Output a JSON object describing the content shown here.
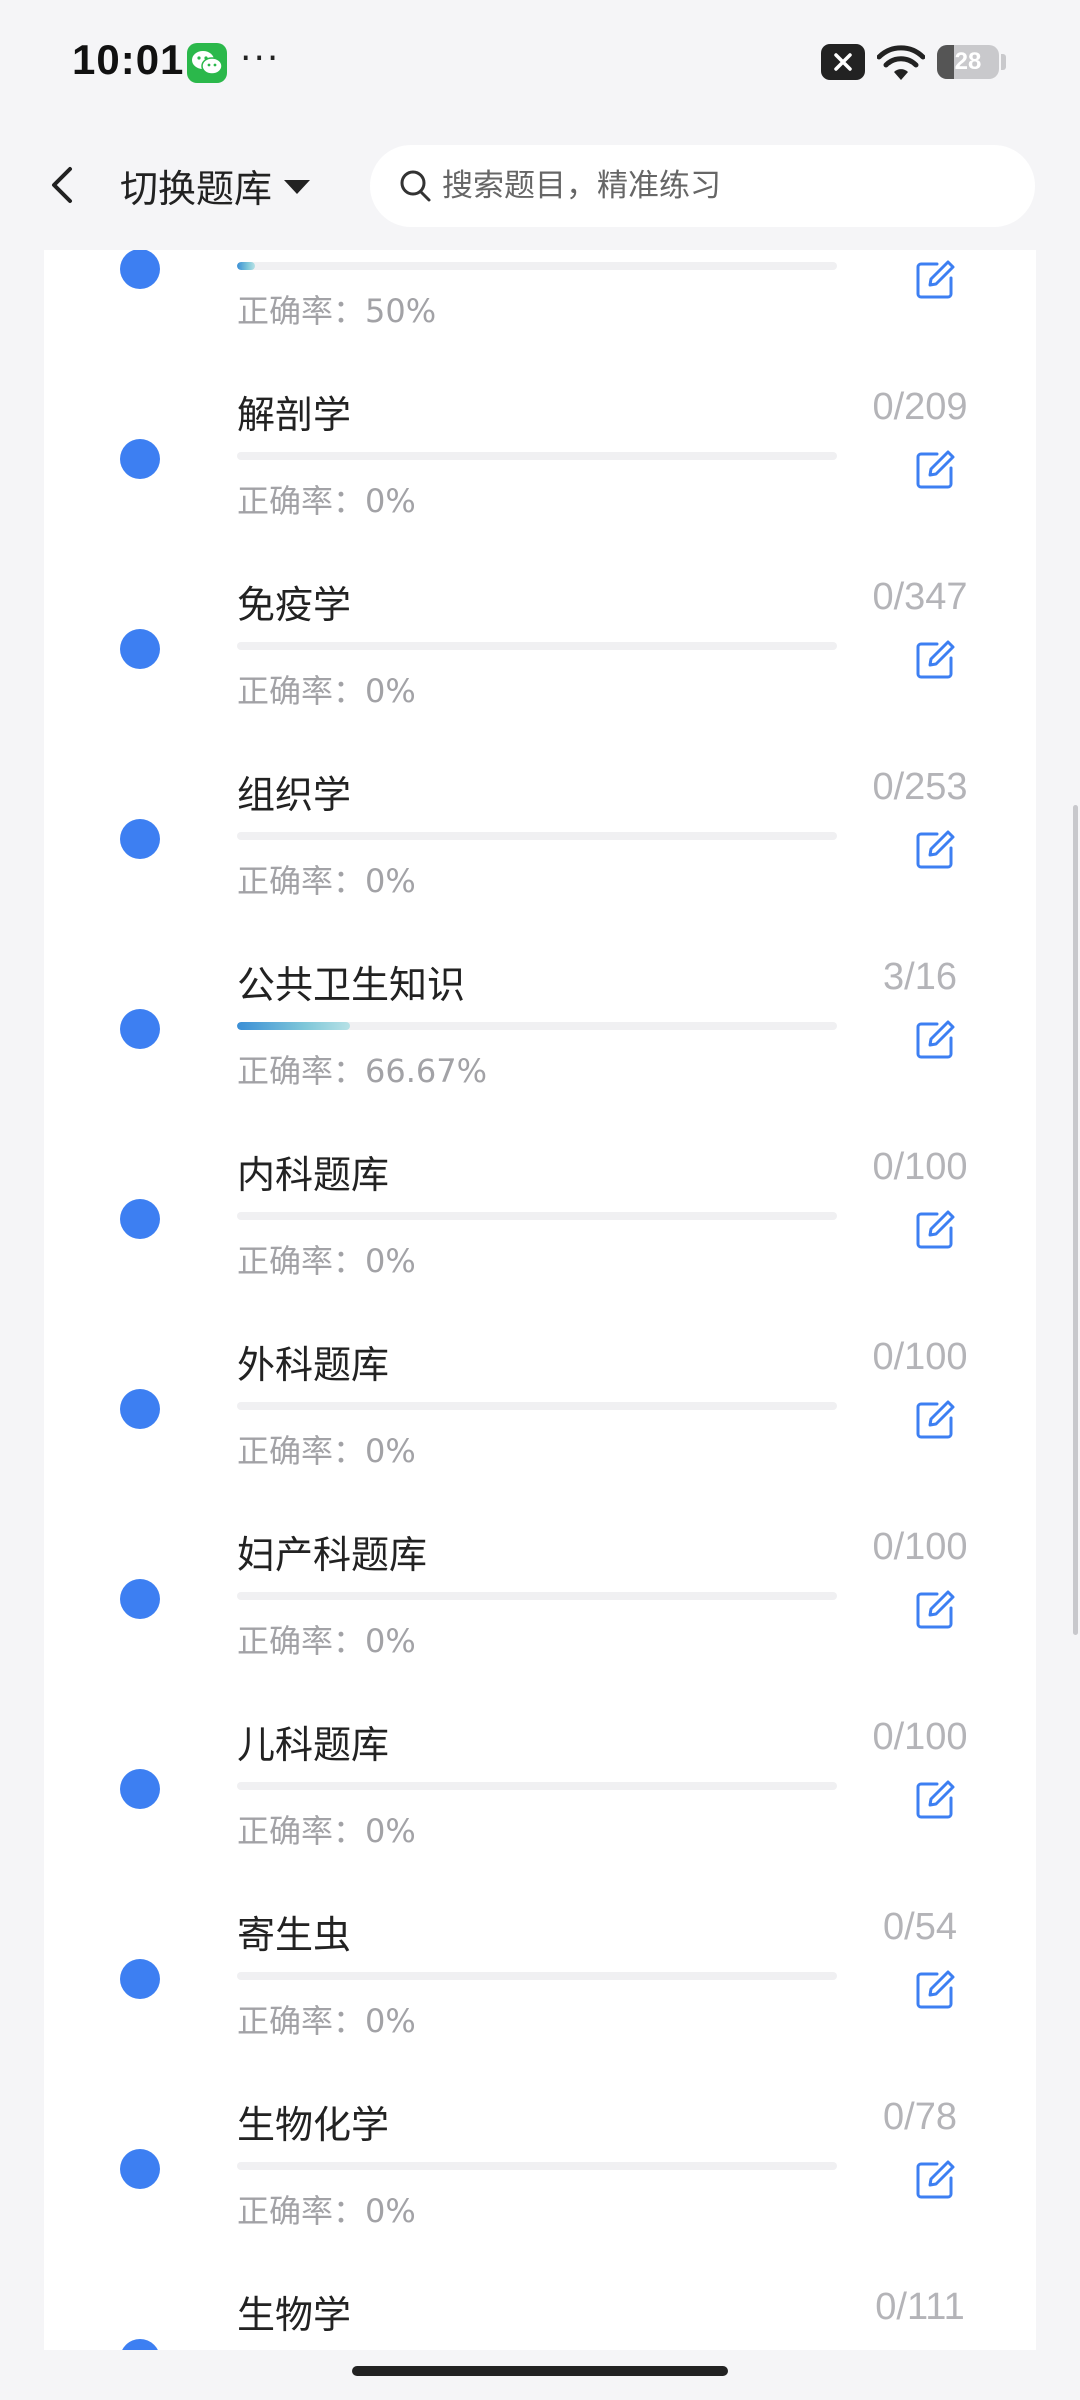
{
  "status_bar": {
    "time": "10:01",
    "more": "···",
    "battery": "28",
    "battery_level": 0.28,
    "icons": [
      "wechat-icon",
      "sim-blocked-icon",
      "wifi-icon",
      "battery-icon"
    ]
  },
  "header": {
    "switch_bank_label": "切换题库",
    "search_placeholder": "搜索题目，精准练习"
  },
  "items": [
    {
      "title": "",
      "progress": 0.03,
      "accuracy": "正确率：50%",
      "count": ""
    },
    {
      "title": "解剖学",
      "progress": 0,
      "accuracy": "正确率：0%",
      "count": "0/209"
    },
    {
      "title": "免疫学",
      "progress": 0,
      "accuracy": "正确率：0%",
      "count": "0/347"
    },
    {
      "title": "组织学",
      "progress": 0,
      "accuracy": "正确率：0%",
      "count": "0/253"
    },
    {
      "title": "公共卫生知识",
      "progress": 0.1875,
      "accuracy": "正确率：66.67%",
      "count": "3/16"
    },
    {
      "title": "内科题库",
      "progress": 0,
      "accuracy": "正确率：0%",
      "count": "0/100"
    },
    {
      "title": "外科题库",
      "progress": 0,
      "accuracy": "正确率：0%",
      "count": "0/100"
    },
    {
      "title": "妇产科题库",
      "progress": 0,
      "accuracy": "正确率：0%",
      "count": "0/100"
    },
    {
      "title": "儿科题库",
      "progress": 0,
      "accuracy": "正确率：0%",
      "count": "0/100"
    },
    {
      "title": "寄生虫",
      "progress": 0,
      "accuracy": "正确率：0%",
      "count": "0/54"
    },
    {
      "title": "生物化学",
      "progress": 0,
      "accuracy": "正确率：0%",
      "count": "0/78"
    },
    {
      "title": "生物学",
      "progress": 0,
      "accuracy": "",
      "count": "0/111"
    }
  ],
  "colors": {
    "accent": "#3d7ff2",
    "progress_start": "#3b8fd6",
    "progress_end": "#b7e1e6"
  }
}
